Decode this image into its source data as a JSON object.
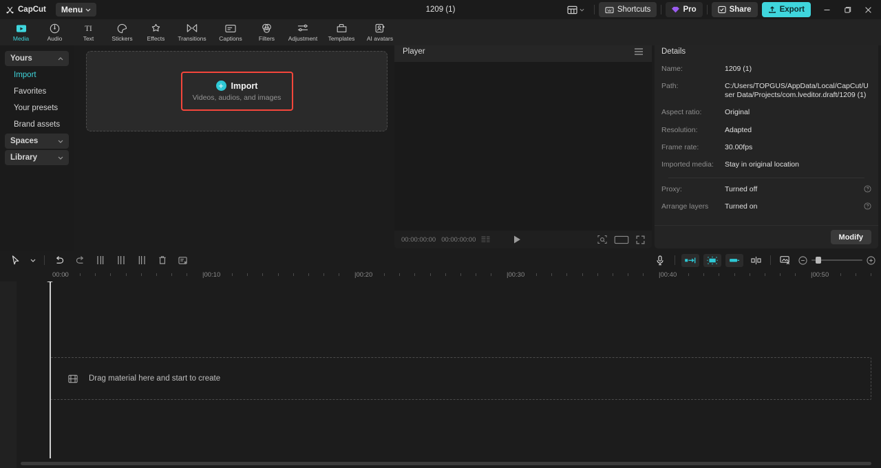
{
  "titlebar": {
    "brand": "CapCut",
    "menu_label": "Menu",
    "project_title": "1209 (1)",
    "shortcuts_label": "Shortcuts",
    "pro_label": "Pro",
    "share_label": "Share",
    "export_label": "Export",
    "accent_cyan": "#3fd6dd",
    "window_buttons": [
      "minimize",
      "maximize",
      "close"
    ]
  },
  "navtabs": [
    {
      "label": "Media",
      "icon": "media-icon",
      "active": true
    },
    {
      "label": "Audio",
      "icon": "audio-icon",
      "active": false
    },
    {
      "label": "Text",
      "icon": "text-icon",
      "active": false
    },
    {
      "label": "Stickers",
      "icon": "stickers-icon",
      "active": false
    },
    {
      "label": "Effects",
      "icon": "effects-icon",
      "active": false
    },
    {
      "label": "Transitions",
      "icon": "transitions-icon",
      "active": false
    },
    {
      "label": "Captions",
      "icon": "captions-icon",
      "active": false
    },
    {
      "label": "Filters",
      "icon": "filters-icon",
      "active": false
    },
    {
      "label": "Adjustment",
      "icon": "adjustment-icon",
      "active": false
    },
    {
      "label": "Templates",
      "icon": "templates-icon",
      "active": false
    },
    {
      "label": "AI avatars",
      "icon": "ai-avatars-icon",
      "active": false
    }
  ],
  "sidebar": {
    "items": [
      {
        "label": "Yours",
        "type": "group",
        "expanded": true,
        "selected": false
      },
      {
        "label": "Import",
        "type": "sub",
        "selected": true
      },
      {
        "label": "Favorites",
        "type": "sub",
        "selected": false
      },
      {
        "label": "Your presets",
        "type": "sub",
        "selected": false
      },
      {
        "label": "Brand assets",
        "type": "sub",
        "selected": false
      },
      {
        "label": "Spaces",
        "type": "group",
        "expanded": false,
        "selected": false
      },
      {
        "label": "Library",
        "type": "group",
        "expanded": false,
        "selected": false
      }
    ]
  },
  "media": {
    "import_label": "Import",
    "import_sub": "Videos, audios, and images",
    "highlight_color": "#f5463b"
  },
  "player": {
    "title": "Player",
    "current_time": "00:00:00:00",
    "total_time": "00:00:00:00"
  },
  "details": {
    "title": "Details",
    "rows": [
      {
        "key": "Name:",
        "value": "1209 (1)"
      },
      {
        "key": "Path:",
        "value": "C:/Users/TOPGUS/AppData/Local/CapCut/User Data/Projects/com.lveditor.draft/1209 (1)"
      },
      {
        "key": "Aspect ratio:",
        "value": "Original"
      },
      {
        "key": "Resolution:",
        "value": "Adapted"
      },
      {
        "key": "Frame rate:",
        "value": "30.00fps"
      },
      {
        "key": "Imported media:",
        "value": "Stay in original location"
      }
    ],
    "rows2": [
      {
        "key": "Proxy:",
        "value": "Turned off",
        "info": true
      },
      {
        "key": "Arrange layers",
        "value": "Turned on",
        "info": true
      }
    ],
    "modify_label": "Modify"
  },
  "timeline": {
    "tools_left": [
      "select-cursor-icon",
      "cursor-dropdown-icon",
      "undo-icon",
      "redo-icon",
      "split-left-icon",
      "split-icon",
      "split-right-icon",
      "delete-icon",
      "crop-icon"
    ],
    "tools_right": [
      "microphone-icon",
      "speed-ramp-icon",
      "auto-cutout-icon",
      "keyframe-icon",
      "split-mirror-icon",
      "preview-render-icon"
    ],
    "ruler_labels": [
      "00:00",
      "|00:10",
      "|00:20",
      "|00:30",
      "|00:40",
      "|00:50"
    ],
    "dropzone_text": "Drag material here and start to create",
    "zoom_out_label": "zoom-out-icon",
    "zoom_in_label": "zoom-in-icon"
  }
}
